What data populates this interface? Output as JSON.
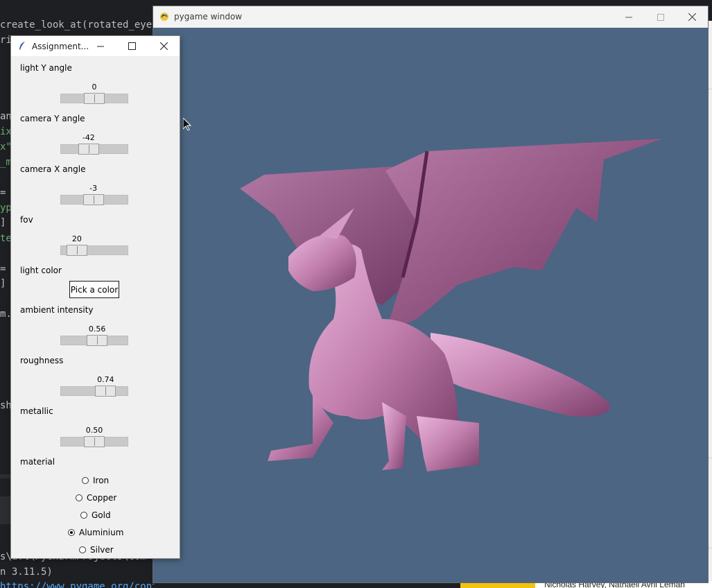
{
  "editor": {
    "lines": [
      {
        "text": "create_look_at(rotated_eye,",
        "cls": ""
      },
      {
        "text": "ri",
        "cls": ""
      },
      {
        "text": "an",
        "cls": ""
      },
      {
        "text": "ix",
        "cls": "green"
      },
      {
        "text": "x\"",
        "cls": "green"
      },
      {
        "text": "_m",
        "cls": "green"
      },
      {
        "text": "=",
        "cls": ""
      },
      {
        "text": "yp",
        "cls": "green"
      },
      {
        "text": "]",
        "cls": ""
      },
      {
        "text": "te",
        "cls": "green"
      },
      {
        "text": "=",
        "cls": ""
      },
      {
        "text": "]",
        "cls": ""
      },
      {
        "text": "m.",
        "cls": ""
      },
      {
        "text": "sh",
        "cls": ""
      },
      {
        "text": "s\\u.l\\PycharmProjects\\com",
        "cls": ""
      },
      {
        "text": "n 3.11.5)",
        "cls": ""
      },
      {
        "text": "https://www.pygame.org/contribute.html",
        "cls": "blue"
      }
    ]
  },
  "background_right": {
    "names_text": "Nicholas Harvey, Nathaell Avril Leman"
  },
  "pygame_window": {
    "title": "pygame window",
    "icons": {
      "logo": "pygame-snake-icon",
      "minimize": "minimize-icon",
      "maximize": "maximize-icon",
      "close": "close-icon"
    },
    "background_color": "#4b6582",
    "model": {
      "name": "dragon-model",
      "color": "#c27fae"
    }
  },
  "tk_window": {
    "title": "Assignment...",
    "icons": {
      "app": "feather-icon",
      "minimize": "minimize-icon",
      "maximize": "maximize-icon",
      "close": "close-icon"
    },
    "controls": {
      "light_y": {
        "label": "light Y angle",
        "value": "0",
        "fraction": 0.5
      },
      "camera_y": {
        "label": "camera Y angle",
        "value": "-42",
        "fraction": 0.38
      },
      "camera_x": {
        "label": "camera X angle",
        "value": "-3",
        "fraction": 0.48
      },
      "fov": {
        "label": "fov",
        "value": "20",
        "fraction": 0.13
      },
      "light_color": {
        "label": "light color",
        "button": "Pick a color"
      },
      "ambient": {
        "label": "ambient intensity",
        "value": "0.56",
        "fraction": 0.56
      },
      "roughness": {
        "label": "roughness",
        "value": "0.74",
        "fraction": 0.74
      },
      "metallic": {
        "label": "metallic",
        "value": "0.50",
        "fraction": 0.5
      },
      "material": {
        "label": "material",
        "selected": "Aluminium",
        "options": [
          "Iron",
          "Copper",
          "Gold",
          "Aluminium",
          "Silver"
        ]
      }
    }
  }
}
